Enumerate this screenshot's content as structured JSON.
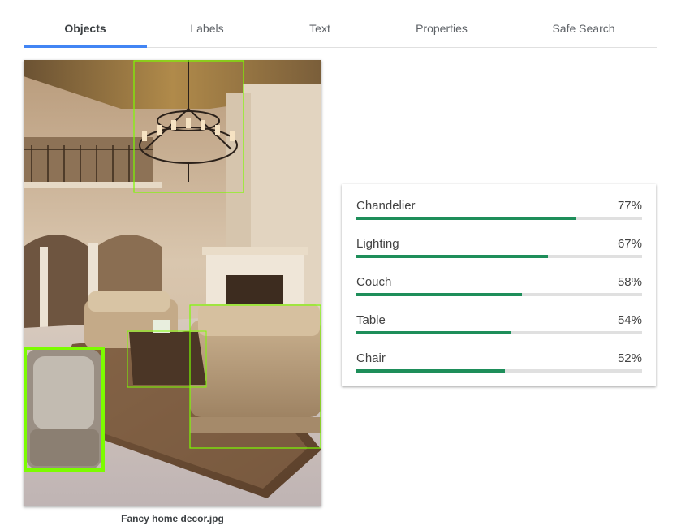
{
  "tabs": [
    {
      "label": "Objects",
      "active": true
    },
    {
      "label": "Labels",
      "active": false
    },
    {
      "label": "Text",
      "active": false
    },
    {
      "label": "Properties",
      "active": false
    },
    {
      "label": "Safe Search",
      "active": false
    }
  ],
  "image": {
    "caption": "Fancy home decor.jpg"
  },
  "results": [
    {
      "name": "Chandelier",
      "score": "77%",
      "fraction": 0.77
    },
    {
      "name": "Lighting",
      "score": "67%",
      "fraction": 0.67
    },
    {
      "name": "Couch",
      "score": "58%",
      "fraction": 0.58
    },
    {
      "name": "Table",
      "score": "54%",
      "fraction": 0.54
    },
    {
      "name": "Chair",
      "score": "52%",
      "fraction": 0.52
    }
  ],
  "colors": {
    "tab_indicator": "#4285f4",
    "score_bar": "#1e8e5a",
    "bbox_outline": "#7cfc00"
  }
}
